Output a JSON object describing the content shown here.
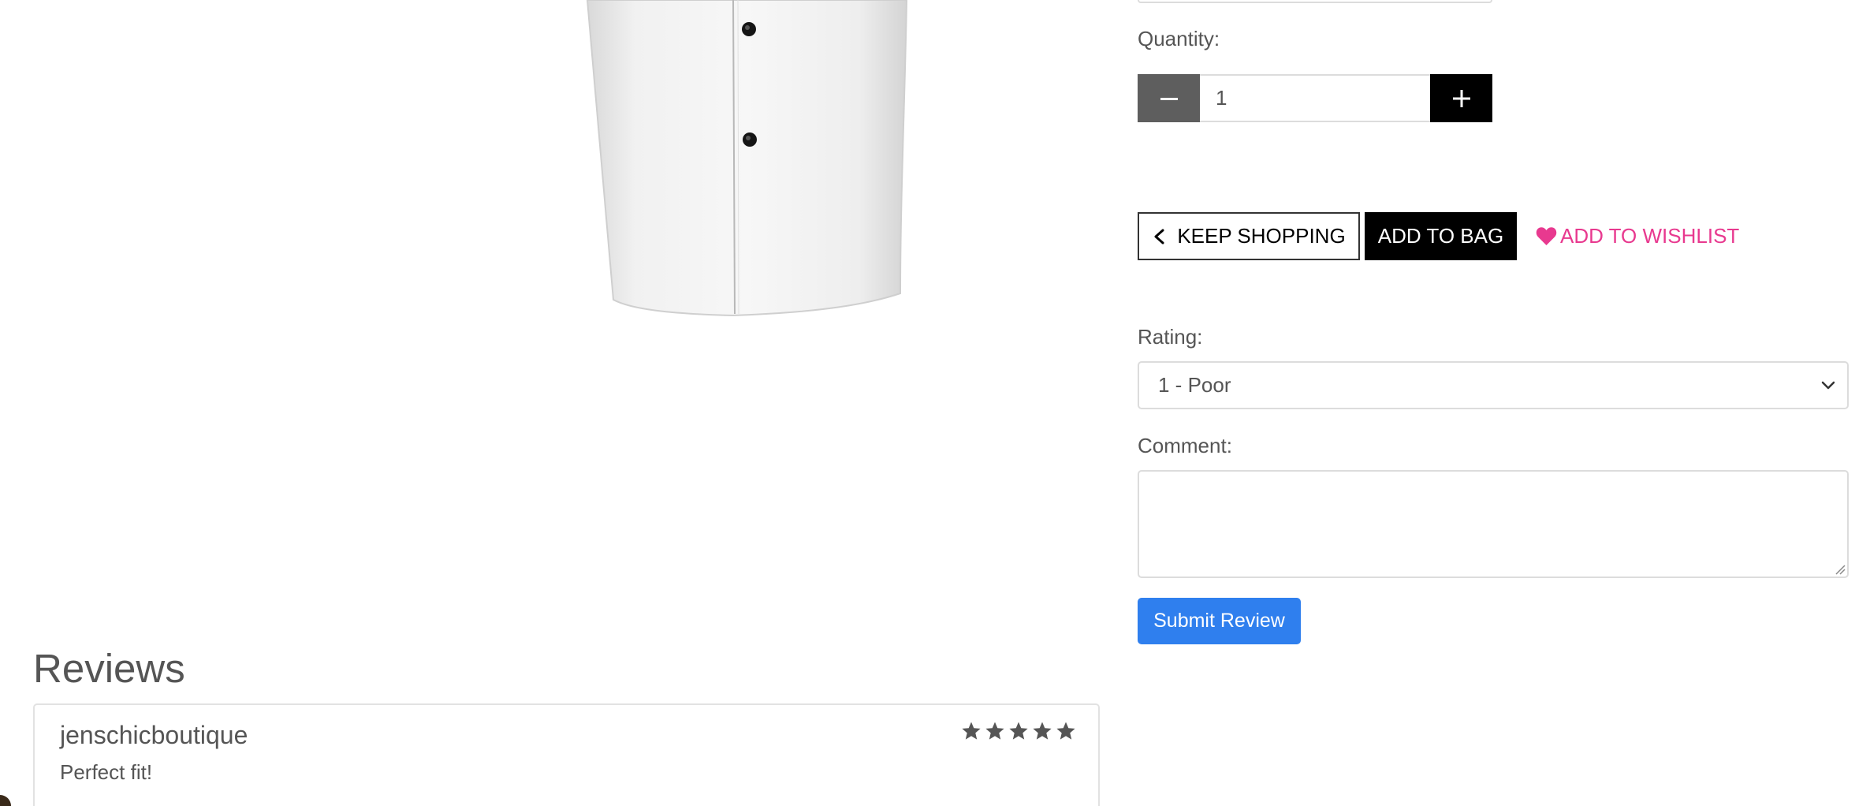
{
  "product": {
    "image_alt": "white shirt product photo"
  },
  "quantity": {
    "label": "Quantity:",
    "value": "1",
    "decrement_icon": "minus-icon",
    "increment_icon": "plus-icon"
  },
  "actions": {
    "keep_shopping_label": "KEEP SHOPPING",
    "add_to_bag_label": "ADD TO BAG",
    "wishlist_label": "ADD TO WISHLIST",
    "wishlist_color": "#e8398f"
  },
  "review_form": {
    "rating_label": "Rating:",
    "rating_selected": "1 - Poor",
    "comment_label": "Comment:",
    "comment_value": "",
    "submit_label": "Submit Review",
    "submit_color": "#2f7fee"
  },
  "reviews": {
    "heading": "Reviews",
    "items": [
      {
        "author": "jenschicboutique",
        "text": "Perfect fit!",
        "stars": 5
      }
    ]
  }
}
